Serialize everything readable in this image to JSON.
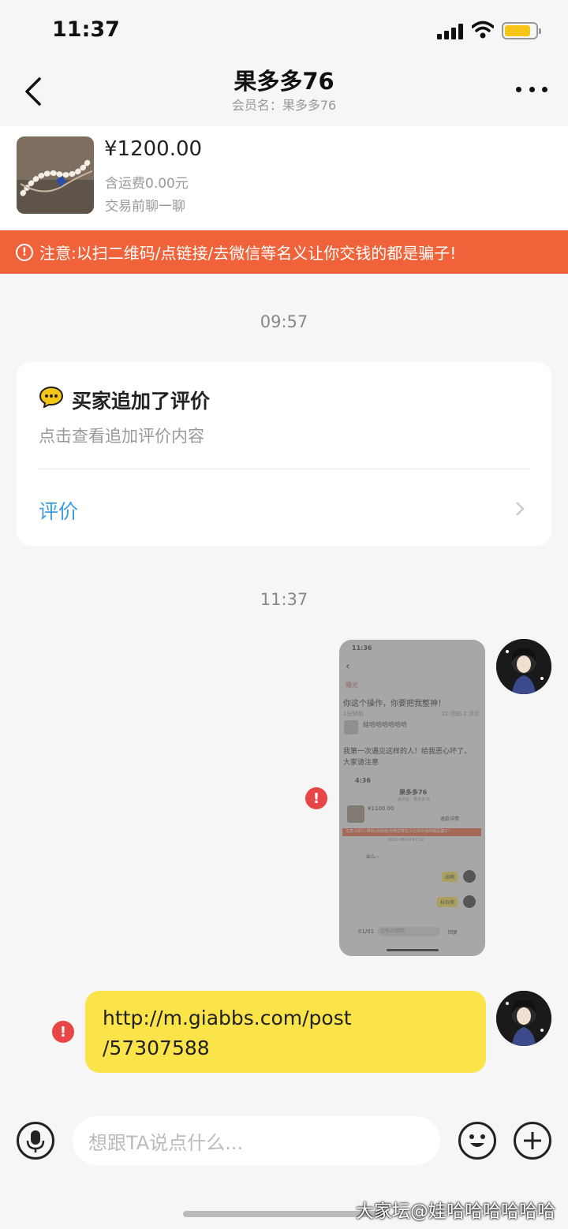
{
  "status_bar": {
    "time": "11:37"
  },
  "nav": {
    "title": "果多多76",
    "subtitle": "会员名：果多多76"
  },
  "product": {
    "price": "¥1200.00",
    "shipping": "含运费0.00元",
    "note": "交易前聊一聊"
  },
  "warning": {
    "icon": "!",
    "text": "注意:以扫二维码/点链接/去微信等名义让你交钱的都是骗子!"
  },
  "timestamps": {
    "first": "09:57",
    "second": "11:37"
  },
  "review_card": {
    "icon": "chat-bubble-icon",
    "title": "买家追加了评价",
    "description": "点击查看追加评价内容",
    "link_label": "评价"
  },
  "messages": {
    "screenshot": {
      "status_time": "11:36",
      "tab": "曝光",
      "post_title": "你这个操作，你要把我整神！",
      "post_time": "1分钟前",
      "post_stats": "20 回帖  2 评论",
      "author": "娃哈哈哈哈哈哈",
      "body_line1": "我第一次遇见这样的人！给我恶心坏了，",
      "body_line2": "大家请注意",
      "inner_time": "4:36",
      "inner_title": "果多多76",
      "inner_sub": "会员名：果多多76",
      "inner_price": "¥1100.00",
      "inner_action": "退款详情",
      "inner_warning": "注意:以扫二维码/点链接/去微信等名义让你交钱的都是骗子!",
      "inner_date": "2021-08-10 07:10",
      "inner_msg1": "出么~",
      "inner_msg2": "出啊",
      "inner_msg3": "标价卖",
      "bottom_page": "01/01",
      "bottom_input": "已有20回帖",
      "bottom_reply": "回复"
    },
    "link_text_line1": "http://m.giabbs.com/post",
    "link_text_line2": "/57307588",
    "failed_marker": "!"
  },
  "input_bar": {
    "placeholder": "想跟TA说点什么..."
  },
  "watermark": "大家坛@娃哈哈哈哈哈哈",
  "colors": {
    "warning_bg": "#f0633a",
    "bubble": "#fbe34a",
    "link": "#3a9de6",
    "alert": "#e84646"
  }
}
